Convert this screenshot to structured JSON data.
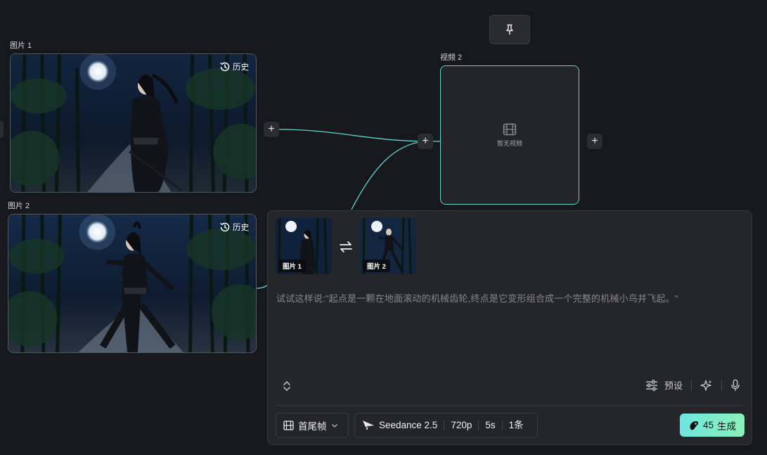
{
  "nodes": {
    "image1": {
      "label": "图片 1",
      "history_label": "历史"
    },
    "image2": {
      "label": "图片 2",
      "history_label": "历史"
    },
    "video2": {
      "label": "视频 2",
      "empty_text": "暂无视频"
    }
  },
  "panel": {
    "references": [
      {
        "tag": "图片 1"
      },
      {
        "tag": "图片 2"
      }
    ],
    "prompt_placeholder": "试试这样说:\"起点是一颗在地面滚动的机械齿轮,终点是它变形组合成一个完整的机械小鸟并飞起。\"",
    "preset_label": "预设",
    "mode_label": "首尾帧",
    "model": {
      "name": "Seedance 2.5",
      "resolution": "720p",
      "duration": "5s",
      "count": "1条"
    },
    "generate": {
      "cost": "45",
      "label": "生成"
    }
  },
  "colors": {
    "accent": "#5fd3d0",
    "generate_start": "#6ee6e0",
    "generate_end": "#8cf0b8",
    "background": "#17181b",
    "panel": "#252629"
  },
  "icons": {
    "pin": "pin-icon",
    "history": "history-icon",
    "film": "film-icon",
    "swap": "swap-icon",
    "expand": "expand-icon",
    "preset": "sliders-icon",
    "magic": "sparkle-icon",
    "mic": "microphone-icon",
    "model": "seedance-logo-icon",
    "credit": "credit-icon"
  }
}
